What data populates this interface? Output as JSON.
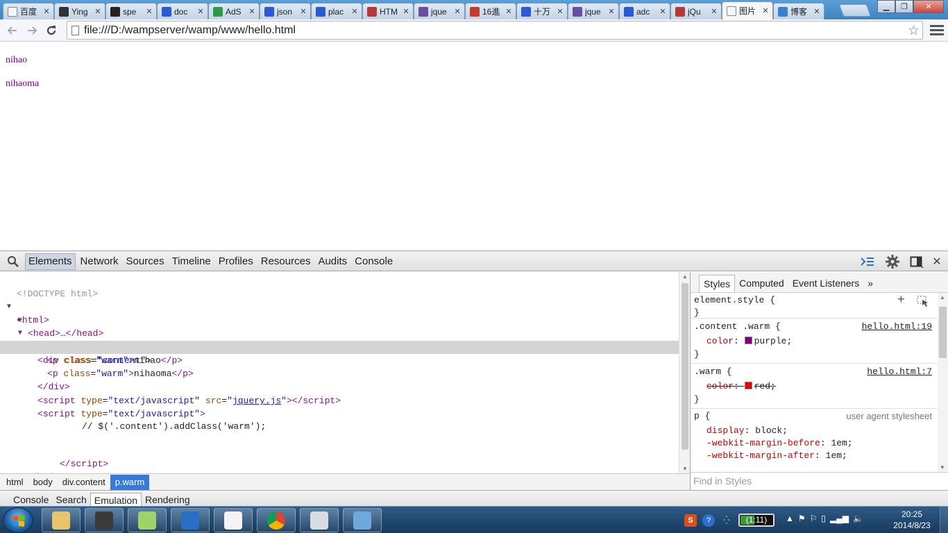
{
  "browser": {
    "tabs": [
      {
        "title": "百度",
        "favicon": "page-icon",
        "color": "#f4f6f9"
      },
      {
        "title": "Ying",
        "favicon": "wordpress-icon",
        "color": "#333333"
      },
      {
        "title": "spe",
        "favicon": "github-icon",
        "color": "#222222"
      },
      {
        "title": "doc",
        "favicon": "baidu-paw-icon",
        "color": "#2b5bd3"
      },
      {
        "title": "AdS",
        "favicon": "ads-icon",
        "color": "#2d9a4a"
      },
      {
        "title": "json",
        "favicon": "baidu-paw-icon",
        "color": "#2b5bd3"
      },
      {
        "title": "plac",
        "favicon": "baidu-paw-icon",
        "color": "#2b5bd3"
      },
      {
        "title": "HTM",
        "favicon": "w3-icon",
        "color": "#b43a3a"
      },
      {
        "title": "jque",
        "favicon": "bug-icon",
        "color": "#6a4ca0"
      },
      {
        "title": "16進",
        "favicon": "b-logo-icon",
        "color": "#c03c2c"
      },
      {
        "title": "十万",
        "favicon": "baidu-paw-icon",
        "color": "#2b5bd3"
      },
      {
        "title": "jque",
        "favicon": "bug-icon",
        "color": "#6a4ca0"
      },
      {
        "title": "adc",
        "favicon": "baidu-paw-icon",
        "color": "#2b5bd3"
      },
      {
        "title": "jQu",
        "favicon": "w3-icon",
        "color": "#b43a3a"
      },
      {
        "title": "图片",
        "favicon": "page-icon",
        "color": "#f4f6f9",
        "active": true
      },
      {
        "title": "博客",
        "favicon": "blog-icon",
        "color": "#3a7fd0"
      }
    ],
    "url": "file:///D:/wampserver/wamp/www/hello.html"
  },
  "page": {
    "lines": [
      "nihao",
      "nihaoma"
    ],
    "text_color": "purple"
  },
  "devtools": {
    "tabs": [
      "Elements",
      "Network",
      "Sources",
      "Timeline",
      "Profiles",
      "Resources",
      "Audits",
      "Console"
    ],
    "active_tab": "Elements",
    "tree": {
      "doctype": "<!DOCTYPE html>",
      "html_open": "html",
      "head": "head",
      "head_ellipsis": "…",
      "body": "body",
      "div_tag": "div",
      "div_attr": "class",
      "div_val": "\"content\"",
      "p1_tag": "p",
      "p1_attr": "class",
      "p1_val": "\"warm\"",
      "p1_text": "nihao",
      "p2_text": "nihaoma",
      "script1_attr1": "type",
      "script1_val1": "\"text/javascript\"",
      "script1_attr2": "src",
      "script1_src": "jquery.js",
      "script2_text": "// $('.content').addClass('warm');",
      "script_close": "script",
      "body_close": "body"
    },
    "breadcrumb": [
      "html",
      "body",
      "div.content",
      "p.warm"
    ],
    "sidebar": {
      "tabs": [
        "Styles",
        "Computed",
        "Event Listeners"
      ],
      "active_tab": "Styles",
      "more": "»",
      "element_style": "element.style {",
      "rule1_selector": ".content .warm {",
      "rule1_source": "hello.html:19",
      "rule1_prop": "color",
      "rule1_value": "purple",
      "rule2_selector": ".warm {",
      "rule2_source": "hello.html:7",
      "rule2_prop": "color",
      "rule2_value": "red",
      "rule3_selector": "p {",
      "rule3_source": "user agent stylesheet",
      "rule3_props": [
        {
          "name": "display",
          "value": "block"
        },
        {
          "name": "-webkit-margin-before",
          "value": "1em"
        },
        {
          "name": "-webkit-margin-after",
          "value": "1em"
        }
      ],
      "find_placeholder": "Find in Styles"
    },
    "drawer_tabs": [
      "Console",
      "Search",
      "Emulation",
      "Rendering"
    ],
    "drawer_active": "Emulation"
  },
  "taskbar": {
    "battery_time": "(1:11)",
    "clock_time": "20:25",
    "clock_date": "2014/8/23",
    "apps": [
      "file-explorer-icon",
      "sublime-text-icon",
      "windows-explorer-icon",
      "lync-icon",
      "java-icon",
      "chrome-icon",
      "magnifier-icon",
      "paint-icon"
    ]
  }
}
